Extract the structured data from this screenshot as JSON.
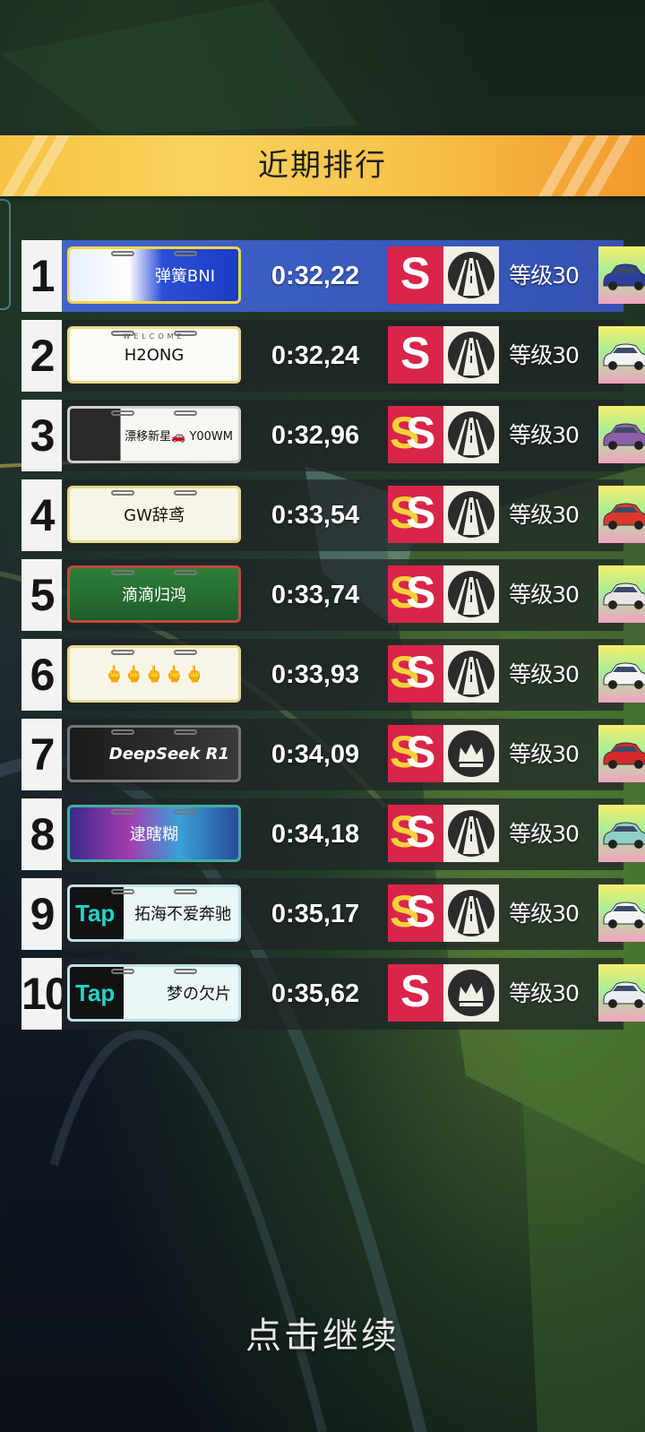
{
  "header": {
    "title": "近期排行"
  },
  "footer": {
    "continue_label": "点击继续"
  },
  "colors": {
    "banner_start": "#f6c243",
    "banner_end": "#f19a2d",
    "first_row": "#3f63c9",
    "badge_red": "#d9254a"
  },
  "rows": [
    {
      "rank": "1",
      "name": "弹簧BNI",
      "time": "0:32,22",
      "grade": "S",
      "icon": "road-icon",
      "level": "等级30",
      "car_color": "#2d3f9e"
    },
    {
      "rank": "2",
      "name": "H2ONG",
      "time": "0:32,24",
      "grade": "S",
      "icon": "road-icon",
      "level": "等级30",
      "car_color": "#f2f2f2"
    },
    {
      "rank": "3",
      "name": "漂移新星🚗 Y00WM",
      "time": "0:32,96",
      "grade": "SS",
      "icon": "road-icon",
      "level": "等级30",
      "car_color": "#8b5fa8"
    },
    {
      "rank": "4",
      "name": "GW辞鸢",
      "time": "0:33,54",
      "grade": "SS",
      "icon": "road-icon",
      "level": "等级30",
      "car_color": "#d93a2b"
    },
    {
      "rank": "5",
      "name": "滴滴归鸿",
      "time": "0:33,74",
      "grade": "SS",
      "icon": "road-icon",
      "level": "等级30",
      "car_color": "#e9e4e6"
    },
    {
      "rank": "6",
      "name": "🖕🖕🖕🖕🖕",
      "time": "0:33,93",
      "grade": "SS",
      "icon": "road-icon",
      "level": "等级30",
      "car_color": "#f4f4f4"
    },
    {
      "rank": "7",
      "name": "DeepSeek R1",
      "time": "0:34,09",
      "grade": "SS",
      "icon": "crown-icon",
      "level": "等级30",
      "car_color": "#d52a2a"
    },
    {
      "rank": "8",
      "name": "逮瞎糊",
      "time": "0:34,18",
      "grade": "SS",
      "icon": "road-icon",
      "level": "等级30",
      "car_color": "#8fd0c6"
    },
    {
      "rank": "9",
      "name": "拓海不爱奔驰",
      "time": "0:35,17",
      "grade": "SS",
      "icon": "road-icon",
      "level": "等级30",
      "car_color": "#f4f4f4"
    },
    {
      "rank": "10",
      "name": "梦の欠片",
      "time": "0:35,62",
      "grade": "S",
      "icon": "crown-icon",
      "level": "等级30",
      "car_color": "#e8eef0"
    }
  ],
  "plates": {
    "welcome_text": "WELCOME",
    "tap_text": "Tap"
  }
}
